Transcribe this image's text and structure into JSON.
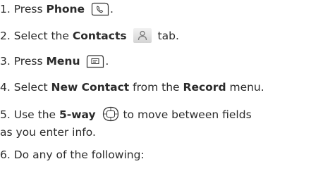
{
  "steps": [
    {
      "num": "1.",
      "parts": [
        "Press ",
        "Phone",
        ""
      ]
    },
    {
      "num": "2.",
      "parts": [
        "Select the ",
        "Contacts",
        " tab."
      ]
    },
    {
      "num": "3.",
      "parts": [
        "Press ",
        "Menu",
        "."
      ]
    },
    {
      "num": "4.",
      "parts": [
        "Select ",
        "New Contact",
        " from the ",
        "Record",
        " menu."
      ]
    },
    {
      "num": "5.",
      "parts": [
        "Use the ",
        "5-way",
        " to move between fields",
        "as you enter info."
      ]
    },
    {
      "num": "6.",
      "parts": [
        "Do any of the following:"
      ]
    }
  ],
  "icons": {
    "phone": "phone-button-icon",
    "contacts": "contacts-tab-icon",
    "menu": "menu-button-icon",
    "fiveway": "five-way-navigator-icon"
  }
}
